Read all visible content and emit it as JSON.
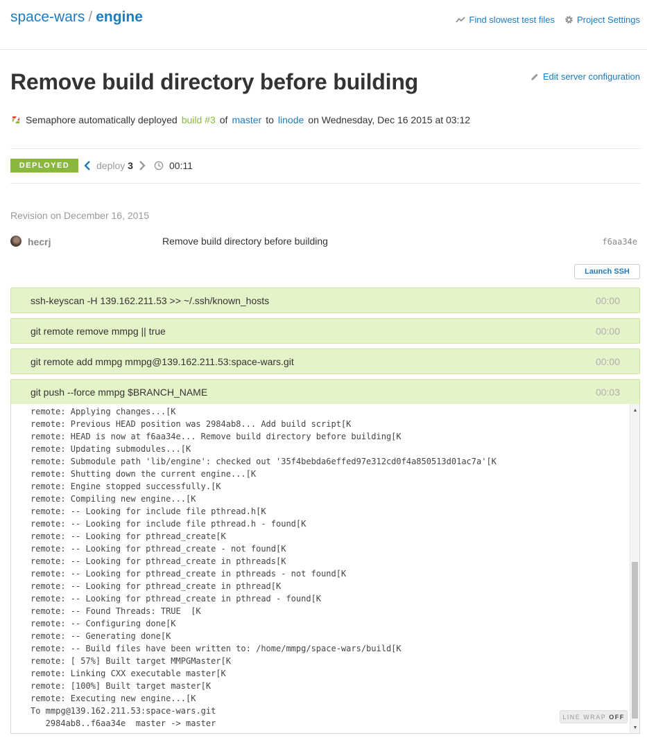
{
  "header": {
    "project": "space-wars",
    "separator": "/",
    "repo": "engine",
    "links": [
      {
        "label": "Find slowest test files",
        "icon": "chart-line-icon"
      },
      {
        "label": "Project Settings",
        "icon": "gear-icon"
      }
    ]
  },
  "title": "Remove build directory before building",
  "edit_config_label": "Edit server configuration",
  "deploy_info": {
    "prefix": "Semaphore automatically deployed",
    "build_label": "build #3",
    "of_word": "of",
    "branch": "master",
    "to_word": "to",
    "server": "linode",
    "datetime": "on Wednesday, Dec 16 2015 at 03:12"
  },
  "status": {
    "badge": "DEPLOYED",
    "badge_color": "#8ab83f",
    "deploy_word": "deploy",
    "deploy_number": "3",
    "duration": "00:11"
  },
  "revision": {
    "date_label": "Revision on December 16, 2015",
    "author": "hecrj",
    "message": "Remove build directory before building",
    "sha": "f6aa34e"
  },
  "launch_ssh_label": "Launch SSH",
  "commands": [
    {
      "text": "ssh-keyscan -H 139.162.211.53 >> ~/.ssh/known_hosts",
      "time": "00:00"
    },
    {
      "text": "git remote remove mmpg || true",
      "time": "00:00"
    },
    {
      "text": "git remote add mmpg mmpg@139.162.211.53:space-wars.git",
      "time": "00:00"
    },
    {
      "text": "git push --force mmpg $BRANCH_NAME",
      "time": "00:03"
    }
  ],
  "log_lines": [
    "remote: Applying changes...[K",
    "remote: Previous HEAD position was 2984ab8... Add build script[K",
    "remote: HEAD is now at f6aa34e... Remove build directory before building[K",
    "remote: Updating submodules...[K",
    "remote: Submodule path 'lib/engine': checked out '35f4bebda6effed97e312cd0f4a850513d01ac7a'[K",
    "remote: Shutting down the current engine...[K",
    "remote: Engine stopped successfully.[K",
    "remote: Compiling new engine...[K",
    "remote: -- Looking for include file pthread.h[K",
    "remote: -- Looking for include file pthread.h - found[K",
    "remote: -- Looking for pthread_create[K",
    "remote: -- Looking for pthread_create - not found[K",
    "remote: -- Looking for pthread_create in pthreads[K",
    "remote: -- Looking for pthread_create in pthreads - not found[K",
    "remote: -- Looking for pthread_create in pthread[K",
    "remote: -- Looking for pthread_create in pthread - found[K",
    "remote: -- Found Threads: TRUE  [K",
    "remote: -- Configuring done[K",
    "remote: -- Generating done[K",
    "remote: -- Build files have been written to: /home/mmpg/space-wars/build[K",
    "remote: [ 57%] Built target MMPGMaster[K",
    "remote: Linking CXX executable master[K",
    "remote: [100%] Built target master[K",
    "remote: Executing new engine...[K",
    "To mmpg@139.162.211.53:space-wars.git",
    "   2984ab8..f6aa34e  master -> master"
  ],
  "line_wrap": {
    "label": "LINE WRAP",
    "state": "OFF"
  }
}
